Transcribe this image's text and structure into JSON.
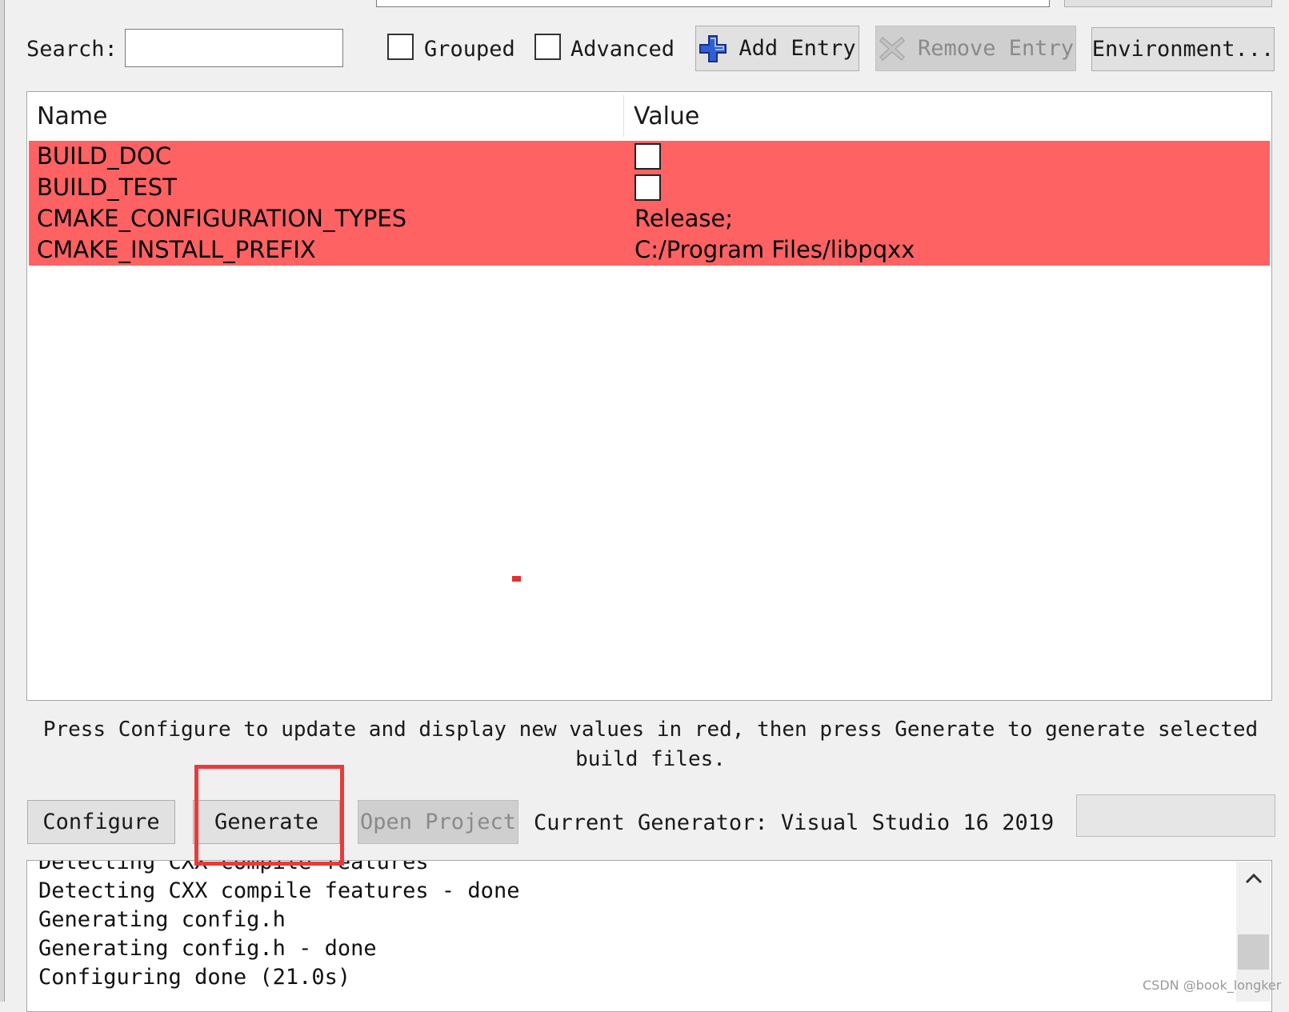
{
  "toolbar": {
    "search_label": "Search:",
    "search_value": "",
    "grouped_label": "Grouped",
    "advanced_label": "Advanced",
    "add_entry_label": "Add Entry",
    "remove_entry_label": "Remove Entry",
    "environment_label": "Environment..."
  },
  "table": {
    "headers": [
      "Name",
      "Value"
    ],
    "rows": [
      {
        "name": "BUILD_DOC",
        "value": "",
        "type": "checkbox",
        "checked": false
      },
      {
        "name": "BUILD_TEST",
        "value": "",
        "type": "checkbox",
        "checked": false
      },
      {
        "name": "CMAKE_CONFIGURATION_TYPES",
        "value": "Release;",
        "type": "text"
      },
      {
        "name": "CMAKE_INSTALL_PREFIX",
        "value": "C:/Program Files/libpqxx",
        "type": "text"
      }
    ],
    "highlight_color": "#ff6262"
  },
  "hint": {
    "text": "Press Configure to update and display new values in red, then press Generate to generate selected build files."
  },
  "actions": {
    "configure_label": "Configure",
    "generate_label": "Generate",
    "open_project_label": "Open Project",
    "generator_text": "Current Generator: Visual Studio 16 2019"
  },
  "log": {
    "lines": [
      "Detecting CXX compile features",
      "Detecting CXX compile features - done",
      "Generating config.h",
      "Generating config.h - done",
      "Configuring done (21.0s)"
    ]
  },
  "annotation": {
    "color": "#e83b3b"
  },
  "watermark": "CSDN @book_longker"
}
